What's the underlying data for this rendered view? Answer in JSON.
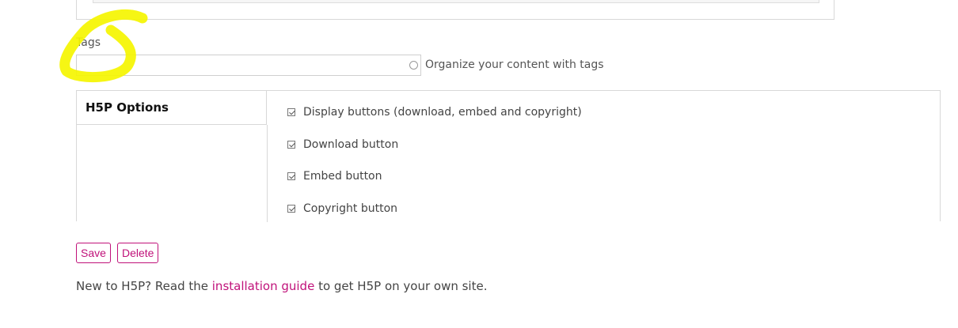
{
  "tags": {
    "label": "Tags",
    "value": "",
    "hint": "Organize your content with tags"
  },
  "h5p_options": {
    "title": "H5P Options",
    "options": [
      {
        "label": "Display buttons (download, embed and copyright)",
        "checked": true
      },
      {
        "label": "Download button",
        "checked": true
      },
      {
        "label": "Embed button",
        "checked": true
      },
      {
        "label": "Copyright button",
        "checked": true
      }
    ]
  },
  "actions": {
    "save_label": "Save",
    "delete_label": "Delete"
  },
  "footer": {
    "prefix": "New to H5P? Read the ",
    "link_text": "installation guide",
    "suffix": " to get H5P on your own site."
  },
  "colors": {
    "accent": "#c0127a",
    "highlight": "#f5f500"
  }
}
